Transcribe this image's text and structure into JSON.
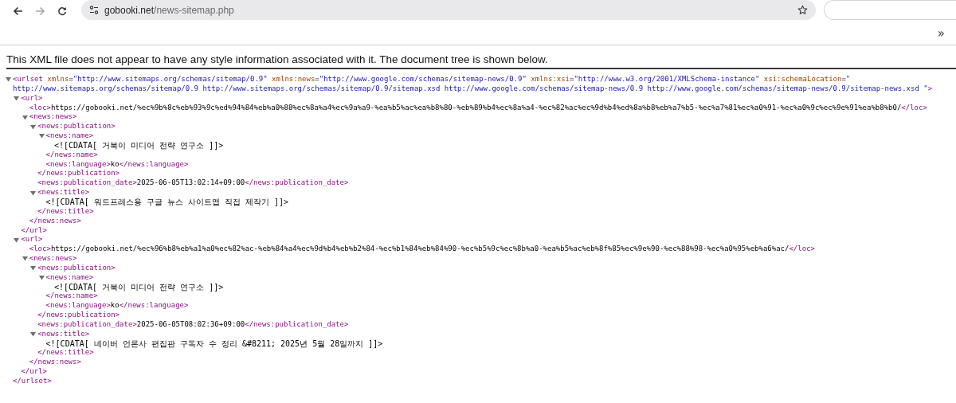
{
  "browser": {
    "nav": [
      {
        "kind": "back",
        "disabled": false
      },
      {
        "kind": "forward",
        "disabled": true
      },
      {
        "kind": "reload",
        "disabled": false
      }
    ],
    "address": {
      "host": "gobooki.net",
      "path": "/news-sitemap.php"
    },
    "bookmarks_overflow": "»"
  },
  "notice": "This XML file does not appear to have any style information associated with it. The document tree is shown below.",
  "tree": [
    {
      "expanded": true,
      "open": [
        [
          {
            "kind": "tag",
            "text": "<urlset"
          },
          {
            "kind": "attr",
            "text": " xmlns"
          },
          {
            "kind": "value",
            "text": "=\"http://www.sitemaps.org/schemas/sitemap/0.9\""
          },
          {
            "kind": "attr",
            "text": " xmlns:news"
          },
          {
            "kind": "value",
            "text": "=\"http://www.google.com/schemas/sitemap-news/0.9\""
          },
          {
            "kind": "attr",
            "text": " xmlns:xsi"
          },
          {
            "kind": "value",
            "text": "=\"http://www.w3.org/2001/XMLSchema-instance\""
          },
          {
            "kind": "attr",
            "text": " xsi:schemaLocation"
          },
          {
            "kind": "value",
            "text": "=\""
          }
        ],
        [
          {
            "kind": "value",
            "text": "http://www.sitemaps.org/schemas/sitemap/0.9 http://www.sitemaps.org/schemas/sitemap/0.9/sitemap.xsd http://www.google.com/schemas/sitemap-news/0.9 http://www.google.com/schemas/sitemap-news/0.9/sitemap-news.xsd \""
          },
          {
            "kind": "tag",
            "text": ">"
          }
        ]
      ],
      "children": [
        {
          "expanded": true,
          "open": [
            [
              {
                "kind": "tag",
                "text": "<url>"
              }
            ]
          ],
          "children": [
            {
              "line": [
                {
                  "kind": "tag",
                  "text": "<loc>"
                },
                {
                  "kind": "text",
                  "text": "https://gobooki.net/%ec%9b%8c%eb%93%9c%ed%94%84%eb%a0%88%ec%8a%a4%ec%9a%a9-%ea%b5%ac%ea%b8%80-%eb%89%b4%ec%8a%a4-%ec%82%ac%ec%9d%b4%ed%8a%b8%eb%a7%b5-%ec%a7%81%ec%a0%91-%ec%a0%9c%ec%9e%91%ea%b8%b0/"
                },
                {
                  "kind": "tag",
                  "text": "</loc>"
                }
              ]
            },
            {
              "expanded": true,
              "open": [
                [
                  {
                    "kind": "tag",
                    "text": "<news:news>"
                  }
                ]
              ],
              "children": [
                {
                  "expanded": true,
                  "open": [
                    [
                      {
                        "kind": "tag",
                        "text": "<news:publication>"
                      }
                    ]
                  ],
                  "children": [
                    {
                      "expanded": true,
                      "open": [
                        [
                          {
                            "kind": "tag",
                            "text": "<news:name>"
                          }
                        ]
                      ],
                      "children": [
                        {
                          "line": [
                            {
                              "kind": "cdata",
                              "text": "<![CDATA[ 거북이 미디어 전략 연구소 ]]>"
                            }
                          ]
                        }
                      ],
                      "close": [
                        {
                          "kind": "tag",
                          "text": "</news:name>"
                        }
                      ]
                    },
                    {
                      "line": [
                        {
                          "kind": "tag",
                          "text": "<news:language>"
                        },
                        {
                          "kind": "text",
                          "text": "ko"
                        },
                        {
                          "kind": "tag",
                          "text": "</news:language>"
                        }
                      ]
                    }
                  ],
                  "close": [
                    {
                      "kind": "tag",
                      "text": "</news:publication>"
                    }
                  ]
                },
                {
                  "line": [
                    {
                      "kind": "tag",
                      "text": "<news:publication_date>"
                    },
                    {
                      "kind": "text",
                      "text": "2025-06-05T13:02:14+09:00"
                    },
                    {
                      "kind": "tag",
                      "text": "</news:publication_date>"
                    }
                  ]
                },
                {
                  "expanded": true,
                  "open": [
                    [
                      {
                        "kind": "tag",
                        "text": "<news:title>"
                      }
                    ]
                  ],
                  "children": [
                    {
                      "line": [
                        {
                          "kind": "cdata",
                          "text": "<![CDATA[ 워드프레스용 구글 뉴스 사이트맵 직접 제작기 ]]>"
                        }
                      ]
                    }
                  ],
                  "close": [
                    {
                      "kind": "tag",
                      "text": "</news:title>"
                    }
                  ]
                }
              ],
              "close": [
                {
                  "kind": "tag",
                  "text": "</news:news>"
                }
              ]
            }
          ],
          "close": [
            {
              "kind": "tag",
              "text": "</url>"
            }
          ]
        },
        {
          "expanded": true,
          "open": [
            [
              {
                "kind": "tag",
                "text": "<url>"
              }
            ]
          ],
          "children": [
            {
              "line": [
                {
                  "kind": "tag",
                  "text": "<loc>"
                },
                {
                  "kind": "text",
                  "text": "https://gobooki.net/%ec%96%b8%eb%a1%a0%ec%82%ac-%eb%84%a4%ec%9d%b4%eb%b2%84-%ec%b1%84%eb%84%90-%ec%b5%9c%ec%8b%a0-%ea%b5%ac%eb%8f%85%ec%9e%90-%ec%88%98-%ec%a0%95%eb%a6%ac/"
                },
                {
                  "kind": "tag",
                  "text": "</loc>"
                }
              ]
            },
            {
              "expanded": true,
              "open": [
                [
                  {
                    "kind": "tag",
                    "text": "<news:news>"
                  }
                ]
              ],
              "children": [
                {
                  "expanded": true,
                  "open": [
                    [
                      {
                        "kind": "tag",
                        "text": "<news:publication>"
                      }
                    ]
                  ],
                  "children": [
                    {
                      "expanded": true,
                      "open": [
                        [
                          {
                            "kind": "tag",
                            "text": "<news:name>"
                          }
                        ]
                      ],
                      "children": [
                        {
                          "line": [
                            {
                              "kind": "cdata",
                              "text": "<![CDATA[ 거북이 미디어 전략 연구소 ]]>"
                            }
                          ]
                        }
                      ],
                      "close": [
                        {
                          "kind": "tag",
                          "text": "</news:name>"
                        }
                      ]
                    },
                    {
                      "line": [
                        {
                          "kind": "tag",
                          "text": "<news:language>"
                        },
                        {
                          "kind": "text",
                          "text": "ko"
                        },
                        {
                          "kind": "tag",
                          "text": "</news:language>"
                        }
                      ]
                    }
                  ],
                  "close": [
                    {
                      "kind": "tag",
                      "text": "</news:publication>"
                    }
                  ]
                },
                {
                  "line": [
                    {
                      "kind": "tag",
                      "text": "<news:publication_date>"
                    },
                    {
                      "kind": "text",
                      "text": "2025-06-05T08:02:36+09:00"
                    },
                    {
                      "kind": "tag",
                      "text": "</news:publication_date>"
                    }
                  ]
                },
                {
                  "expanded": true,
                  "open": [
                    [
                      {
                        "kind": "tag",
                        "text": "<news:title>"
                      }
                    ]
                  ],
                  "children": [
                    {
                      "line": [
                        {
                          "kind": "cdata",
                          "text": "<![CDATA[ 네이버 언론사 편집판 구독자 수 정리 &#8211; 2025년 5월 28일까지 ]]>"
                        }
                      ]
                    }
                  ],
                  "close": [
                    {
                      "kind": "tag",
                      "text": "</news:title>"
                    }
                  ]
                }
              ],
              "close": [
                {
                  "kind": "tag",
                  "text": "</news:news>"
                }
              ]
            }
          ],
          "close": [
            {
              "kind": "tag",
              "text": "</url>"
            }
          ]
        }
      ],
      "close": [
        {
          "kind": "tag",
          "text": "</urlset>"
        }
      ]
    }
  ]
}
